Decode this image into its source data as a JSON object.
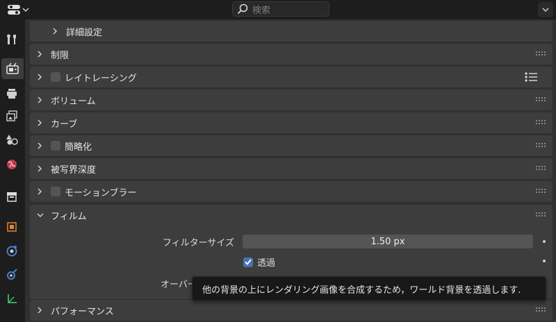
{
  "header": {
    "search_placeholder": "検索"
  },
  "sidebar": {
    "tabs": [
      {
        "icon": "tool-icon"
      },
      {
        "icon": "render-icon",
        "active": true
      },
      {
        "icon": "output-icon"
      },
      {
        "icon": "view-layer-icon"
      },
      {
        "icon": "scene-icon"
      },
      {
        "icon": "world-icon"
      },
      {
        "icon": "collection-icon"
      },
      {
        "icon": "object-icon"
      },
      {
        "icon": "modifier-icon"
      },
      {
        "icon": "physics-icon"
      },
      {
        "icon": "constraints-icon"
      }
    ]
  },
  "panels": {
    "advanced": "詳細設定",
    "limits": "制限",
    "raytracing": "レイトレーシング",
    "volumes": "ボリューム",
    "curves": "カーブ",
    "simplify": "簡略化",
    "dof": "被写界深度",
    "motion_blur": "モーションブラー",
    "film": "フィルム",
    "performance": "パフォーマンス"
  },
  "film": {
    "filter_size_label": "フィルターサイズ",
    "filter_size_value": "1.50 px",
    "transparent_label": "透過",
    "overscan_label": "オーバー"
  },
  "tooltip": {
    "text": "他の背景の上にレンダリング画像を合成するため，ワールド背景を透過します."
  },
  "colors": {
    "accent": "#4772b3",
    "panel_bg": "#3d3d3d",
    "region_bg": "#303030"
  }
}
